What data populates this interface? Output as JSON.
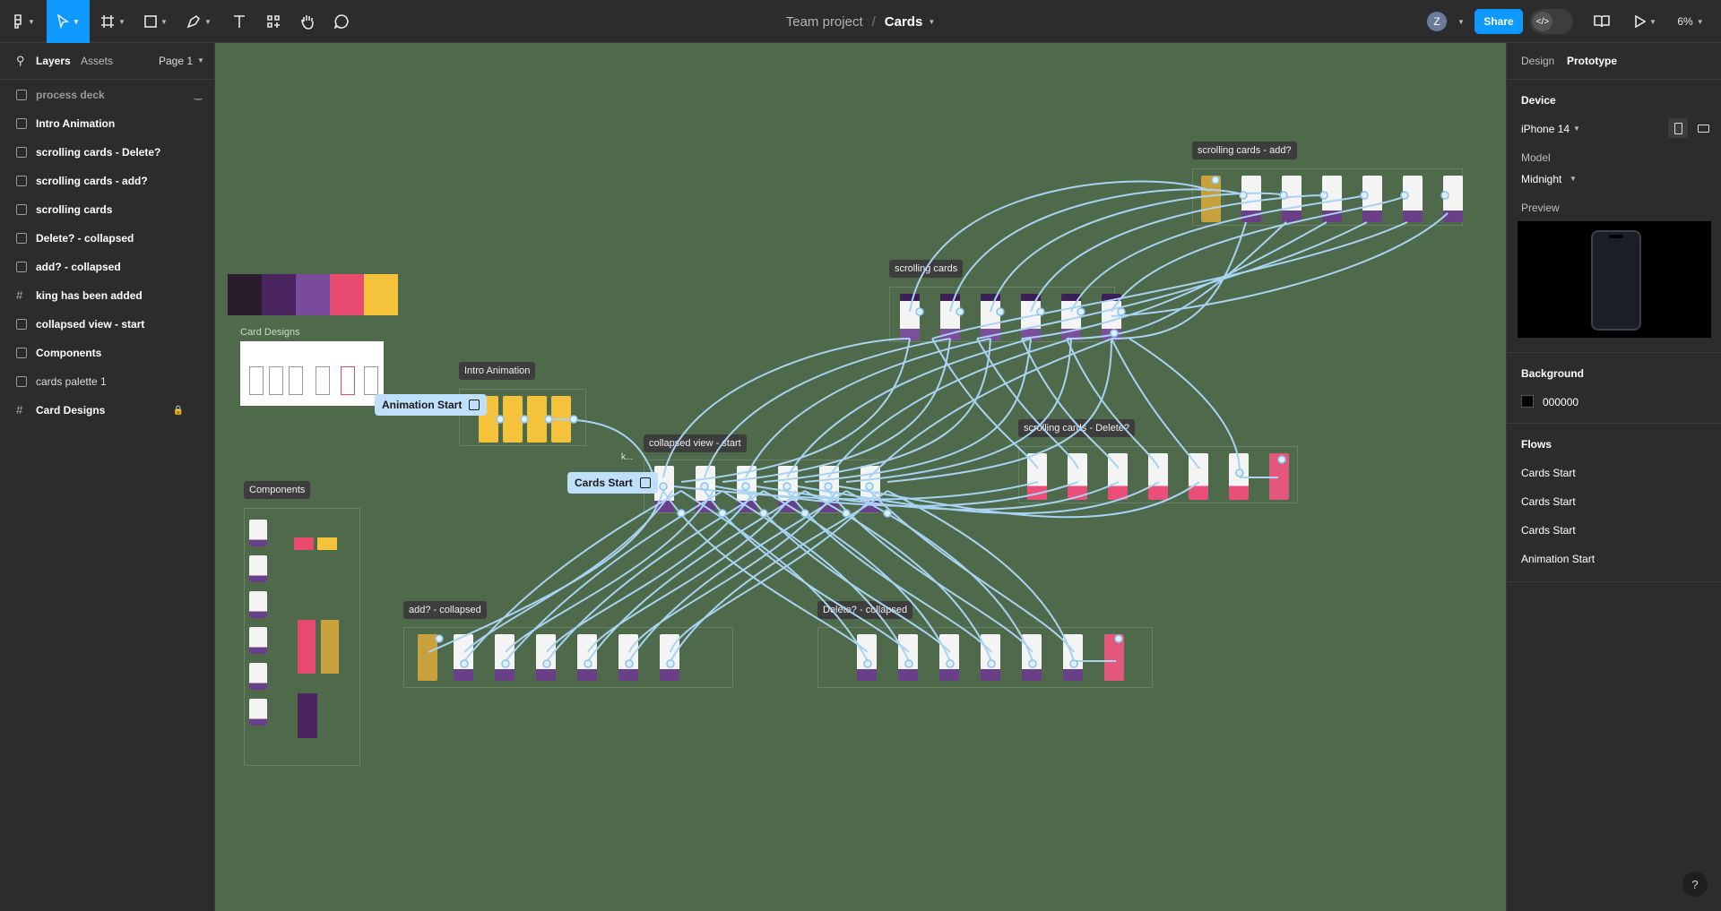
{
  "toolbar": {
    "project": "Team project",
    "separator": "/",
    "file": "Cards",
    "avatar_initial": "Z",
    "share_label": "Share",
    "zoom": "6%"
  },
  "left_panel": {
    "tabs": [
      "Layers",
      "Assets"
    ],
    "page": "Page 1",
    "layers": [
      {
        "label": "process deck",
        "icon": "frame-icon",
        "hidden": true
      },
      {
        "label": "Intro Animation",
        "icon": "frame-icon"
      },
      {
        "label": "scrolling cards - Delete?",
        "icon": "frame-icon"
      },
      {
        "label": "scrolling cards - add?",
        "icon": "frame-icon"
      },
      {
        "label": "scrolling cards",
        "icon": "frame-icon"
      },
      {
        "label": "Delete? - collapsed",
        "icon": "frame-icon"
      },
      {
        "label": "add? - collapsed",
        "icon": "frame-icon"
      },
      {
        "label": "king has been added",
        "icon": "grid-icon"
      },
      {
        "label": "collapsed view - start",
        "icon": "frame-icon"
      },
      {
        "label": "Components",
        "icon": "frame-icon"
      },
      {
        "label": "cards palette 1",
        "icon": "image-icon"
      },
      {
        "label": "Card Designs",
        "icon": "grid-icon",
        "locked": true
      }
    ]
  },
  "canvas": {
    "frames": {
      "scrolling_add": "scrolling cards - add?",
      "scrolling": "scrolling cards",
      "intro": "Intro Animation",
      "collapsed_start": "collapsed view - start",
      "scrolling_delete": "scrolling cards - Delete?",
      "components": "Components",
      "add_collapsed": "add? - collapsed",
      "delete_collapsed": "Delete? - collapsed",
      "card_designs": "Card Designs",
      "small_label": "k..."
    },
    "flow_starts": {
      "animation": "Animation Start",
      "cards": "Cards Start"
    },
    "palette": [
      "#2a1b2d",
      "#4a2560",
      "#7a4a9c",
      "#e84a6f",
      "#f5c33b"
    ]
  },
  "right_panel": {
    "tabs": [
      "Design",
      "Prototype"
    ],
    "device_heading": "Device",
    "device": "iPhone 14",
    "model_heading": "Model",
    "model": "Midnight",
    "preview_heading": "Preview",
    "background_heading": "Background",
    "background_hex": "000000",
    "flows_heading": "Flows",
    "flows": [
      "Cards Start",
      "Cards Start",
      "Cards Start",
      "Animation Start"
    ]
  },
  "help_label": "?"
}
